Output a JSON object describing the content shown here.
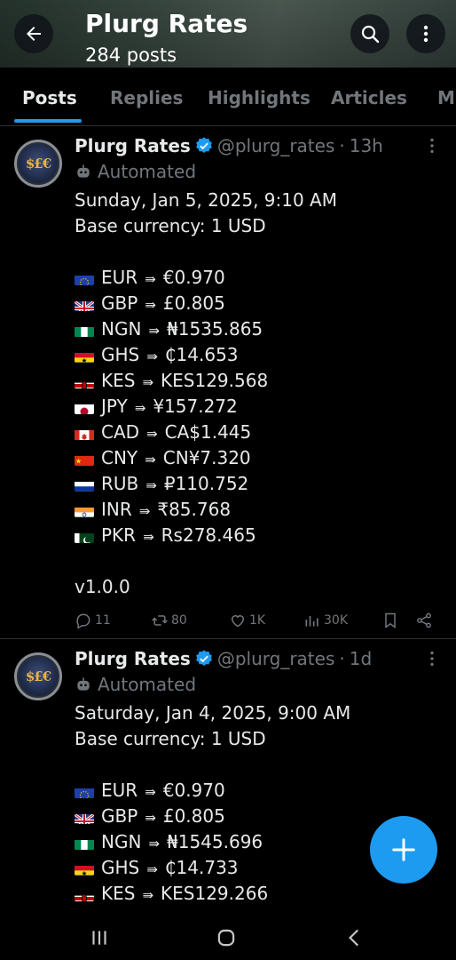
{
  "header": {
    "title": "Plurg Rates",
    "subtitle": "284 posts",
    "back_icon": "arrow-left-icon",
    "search_icon": "search-icon",
    "more_icon": "more-vertical-icon"
  },
  "tabs": [
    {
      "label": "Posts",
      "active": true
    },
    {
      "label": "Replies",
      "active": false
    },
    {
      "label": "Highlights",
      "active": false
    },
    {
      "label": "Articles",
      "active": false
    },
    {
      "label": "M",
      "active": false
    }
  ],
  "colors": {
    "accent": "#1d9bf0",
    "background": "#000000",
    "text_primary": "#e7e9ea",
    "text_secondary": "#71767b",
    "divider": "#2f3336"
  },
  "posts": [
    {
      "name": "Plurg Rates",
      "handle": "@plurg_rates",
      "separator": "·",
      "time": "13h",
      "label": "Automated",
      "date_line": "Sunday, Jan 5, 2025, 9:10 AM",
      "base_line": "Base currency: 1 USD",
      "rates": [
        {
          "code": "EUR",
          "value": "€0.970",
          "flag": "eu"
        },
        {
          "code": "GBP",
          "value": "£0.805",
          "flag": "gb"
        },
        {
          "code": "NGN",
          "value": "₦1535.865",
          "flag": "ng"
        },
        {
          "code": "GHS",
          "value": "₵14.653",
          "flag": "gh"
        },
        {
          "code": "KES",
          "value": "KES129.568",
          "flag": "ke"
        },
        {
          "code": "JPY",
          "value": "¥157.272",
          "flag": "jp"
        },
        {
          "code": "CAD",
          "value": "CA$1.445",
          "flag": "ca"
        },
        {
          "code": "CNY",
          "value": "CN¥7.320",
          "flag": "cn"
        },
        {
          "code": "RUB",
          "value": "₽110.752",
          "flag": "ru"
        },
        {
          "code": "INR",
          "value": "₹85.768",
          "flag": "in"
        },
        {
          "code": "PKR",
          "value": "Rs278.465",
          "flag": "pk"
        }
      ],
      "version": "v1.0.0",
      "stats": {
        "replies": "11",
        "reposts": "80",
        "likes": "1K",
        "views": "30K"
      }
    },
    {
      "name": "Plurg Rates",
      "handle": "@plurg_rates",
      "separator": "·",
      "time": "1d",
      "label": "Automated",
      "date_line": "Saturday, Jan 4, 2025, 9:00 AM",
      "base_line": "Base currency: 1 USD",
      "rates": [
        {
          "code": "EUR",
          "value": "€0.970",
          "flag": "eu"
        },
        {
          "code": "GBP",
          "value": "£0.805",
          "flag": "gb"
        },
        {
          "code": "NGN",
          "value": "₦1545.696",
          "flag": "ng"
        },
        {
          "code": "GHS",
          "value": "₵14.733",
          "flag": "gh"
        },
        {
          "code": "KES",
          "value": "KES129.266",
          "flag": "ke"
        }
      ]
    }
  ],
  "arrow_glyph": "⇛",
  "fab": {
    "icon": "plus-icon"
  },
  "navbar": {
    "recents_icon": "recents-icon",
    "home_icon": "home-icon",
    "back_icon": "nav-back-icon"
  }
}
